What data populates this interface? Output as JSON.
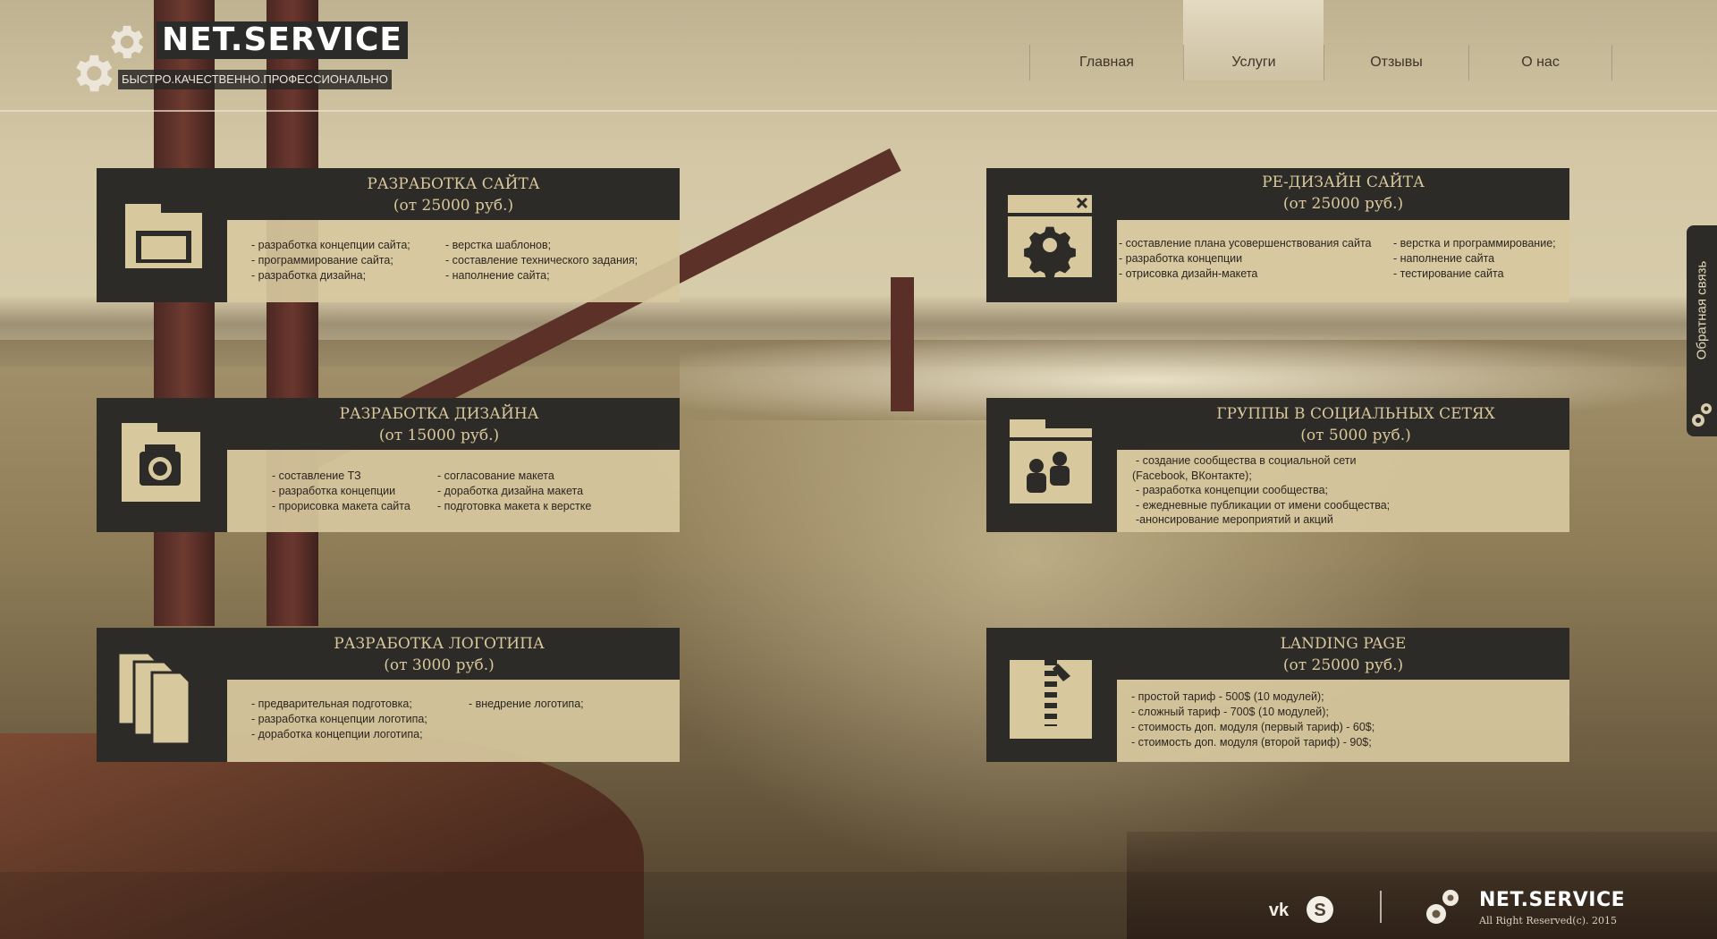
{
  "brand": {
    "name": "NET.SERVICE",
    "slogan": "БЫСТРО.КАЧЕСТВЕННО.ПРОФЕССИОНАЛЬНО"
  },
  "nav": {
    "items": [
      {
        "label": "Главная",
        "active": false
      },
      {
        "label": "Услуги",
        "active": true
      },
      {
        "label": "Отзывы",
        "active": false
      },
      {
        "label": "О нас",
        "active": false
      }
    ]
  },
  "services": [
    {
      "title": "РАЗРАБОТКА САЙТА",
      "price": "(от 25000 руб.)",
      "icon": "window-icon",
      "col1": [
        "разработка концепции сайта;",
        "программирование сайта;",
        "разработка дизайна;"
      ],
      "col2": [
        "верстка шаблонов;",
        "составление технического задания;",
        "наполнение сайта;"
      ]
    },
    {
      "title": "РЕ-ДИЗАЙН САЙТА",
      "price": "(от 25000 руб.)",
      "icon": "settings-window-icon",
      "col1": [
        "составление плана усовершенствования сайта",
        "разработка концепции",
        "отрисовка дизайн-макета"
      ],
      "col2": [
        "верстка и программирование;",
        "наполнение сайта",
        "тестирование сайта"
      ]
    },
    {
      "title": "РАЗРАБОТКА ДИЗАЙНА",
      "price": "(от 15000 руб.)",
      "icon": "camera-icon",
      "col1": [
        "составление ТЗ",
        "разработка концепции",
        "прорисовка макета сайта"
      ],
      "col2": [
        "согласование макета",
        "доработка дизайна макета",
        "подготовка макета к верстке"
      ]
    },
    {
      "title": "ГРУППЫ В СОЦИАЛЬНЫХ СЕТЯХ",
      "price": "(от 5000 руб.)",
      "icon": "users-folder-icon",
      "col1": [
        "создание сообщества в социальной сети",
        "(Facebook, ВКонтакте);",
        "разработка концепции сообщества;",
        "ежедневные публикации от имени сообщества;",
        "-анонсирование мероприятий и акций"
      ]
    },
    {
      "title": "РАЗРАБОТКА ЛОГОТИПА",
      "price": "(от 3000 руб.)",
      "icon": "documents-icon",
      "col1": [
        "предварительная подготовка;",
        "разработка концепции логотипа;",
        "доработка концепции логотипа;"
      ],
      "col2": [
        "внедрение логотипа;"
      ]
    },
    {
      "title": "LANDING PAGE",
      "price": "(от 25000 руб.)",
      "icon": "zip-archive-icon",
      "col1": [
        "простой тариф - 500$ (10 модулей);",
        "сложный тариф - 700$ (10 модулей);",
        "стоимость доп. модуля (первый тариф) - 60$;",
        "стоимость доп. модуля (второй тариф) - 90$;"
      ]
    }
  ],
  "feedback": {
    "label": "Обратная связь"
  },
  "footer": {
    "social": [
      "vk-icon",
      "skype-icon"
    ],
    "brand": "NET.SERVICE",
    "copyright": "All Right Reserved(c). 2015"
  },
  "colors": {
    "card_dark": "#2d2b28",
    "card_body": "#d7c89e",
    "card_title": "#d9c89a",
    "text_dark": "#2b2620"
  }
}
